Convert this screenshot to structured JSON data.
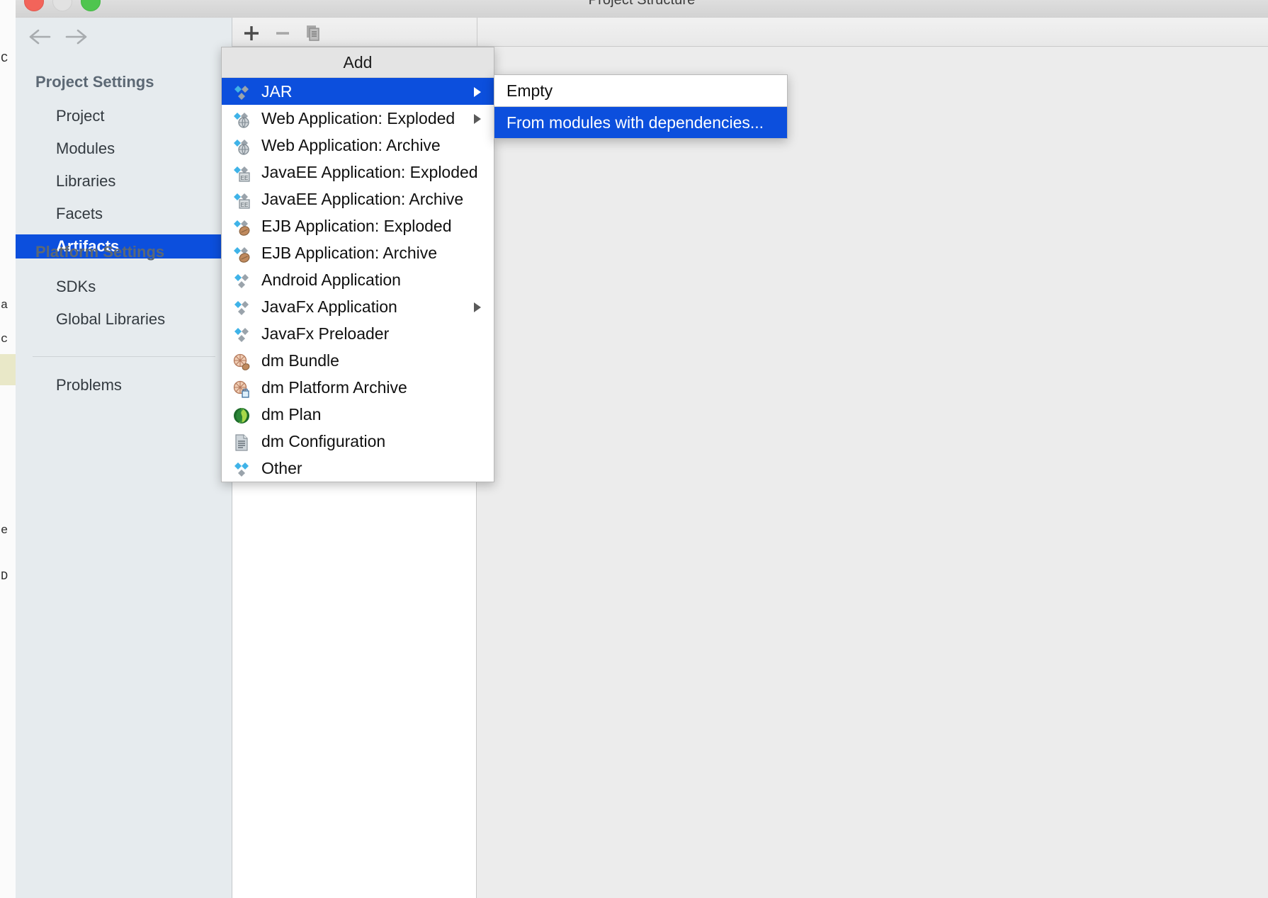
{
  "window": {
    "title": "Project Structure",
    "traffic_lights": [
      "close",
      "minimize",
      "maximize"
    ]
  },
  "toolbar": {
    "add_label": "+",
    "remove_label": "-",
    "copy_label": "copy"
  },
  "sidebar": {
    "nav": {
      "back": "back-arrow",
      "forward": "forward-arrow"
    },
    "groups": [
      {
        "label": "Project Settings"
      },
      {
        "label": "Platform Settings"
      }
    ],
    "project_items": [
      {
        "label": "Project",
        "selected": false
      },
      {
        "label": "Modules",
        "selected": false
      },
      {
        "label": "Libraries",
        "selected": false
      },
      {
        "label": "Facets",
        "selected": false
      },
      {
        "label": "Artifacts",
        "selected": true
      }
    ],
    "platform_items": [
      {
        "label": "SDKs",
        "selected": false
      },
      {
        "label": "Global Libraries",
        "selected": false
      }
    ],
    "other_items": [
      {
        "label": "Problems",
        "selected": false
      }
    ]
  },
  "add_menu": {
    "title": "Add",
    "items": [
      {
        "label": "JAR",
        "icon": "artifact-diamond-icon",
        "submenu": true,
        "highlighted": true
      },
      {
        "label": "Web Application: Exploded",
        "icon": "web-artifact-icon",
        "submenu": true,
        "highlighted": false
      },
      {
        "label": "Web Application: Archive",
        "icon": "web-artifact-icon",
        "submenu": false,
        "highlighted": false
      },
      {
        "label": "JavaEE Application: Exploded",
        "icon": "javaee-artifact-icon",
        "submenu": false,
        "highlighted": false
      },
      {
        "label": "JavaEE Application: Archive",
        "icon": "javaee-artifact-icon",
        "submenu": false,
        "highlighted": false
      },
      {
        "label": "EJB Application: Exploded",
        "icon": "ejb-artifact-icon",
        "submenu": false,
        "highlighted": false
      },
      {
        "label": "EJB Application: Archive",
        "icon": "ejb-artifact-icon",
        "submenu": false,
        "highlighted": false
      },
      {
        "label": "Android Application",
        "icon": "artifact-diamond-icon",
        "submenu": false,
        "highlighted": false
      },
      {
        "label": "JavaFx Application",
        "icon": "artifact-diamond-icon",
        "submenu": true,
        "highlighted": false
      },
      {
        "label": "JavaFx Preloader",
        "icon": "artifact-diamond-icon",
        "submenu": false,
        "highlighted": false
      },
      {
        "label": "dm Bundle",
        "icon": "dm-bundle-icon",
        "submenu": false,
        "highlighted": false
      },
      {
        "label": "dm Platform Archive",
        "icon": "dm-platform-archive-icon",
        "submenu": false,
        "highlighted": false
      },
      {
        "label": "dm Plan",
        "icon": "dm-plan-icon",
        "submenu": false,
        "highlighted": false
      },
      {
        "label": "dm Configuration",
        "icon": "dm-configuration-icon",
        "submenu": false,
        "highlighted": false
      },
      {
        "label": "Other",
        "icon": "artifact-diamond-icon",
        "submenu": false,
        "highlighted": false
      }
    ]
  },
  "jar_submenu": {
    "items": [
      {
        "label": "Empty",
        "highlighted": false
      },
      {
        "label": "From modules with dependencies...",
        "highlighted": true
      }
    ]
  },
  "colors": {
    "selection_blue": "#0c4fdd",
    "sidebar_bg": "#e6ebee",
    "panel_bg": "#ececec",
    "menu_bg": "#ffffff",
    "menu_header_bg": "#e4e4e4",
    "icon_cyan": "#3fb3e8",
    "icon_gray": "#9aa3ab",
    "group_label": "#5c6874"
  }
}
